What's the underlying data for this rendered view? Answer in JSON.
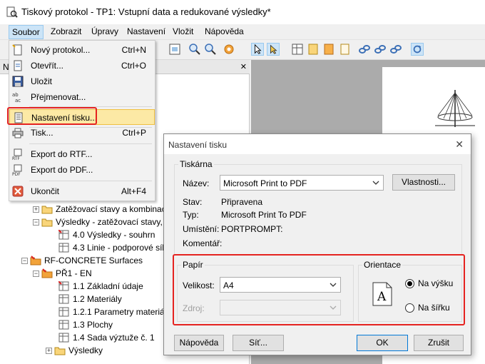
{
  "window": {
    "title": "Tiskový protokol - TP1: Vstupní data a redukované výsledky*"
  },
  "menubar": {
    "items": [
      "Soubor",
      "Zobrazit",
      "Úpravy",
      "Nastavení",
      "Vložit",
      "Nápověda"
    ]
  },
  "file_menu": {
    "items": [
      {
        "label": "Nový protokol...",
        "shortcut": "Ctrl+N",
        "icon": "new-document-icon"
      },
      {
        "label": "Otevřít...",
        "shortcut": "Ctrl+O",
        "icon": "open-folder-icon"
      },
      {
        "label": "Uložit",
        "shortcut": "",
        "icon": "save-disk-icon"
      },
      {
        "label": "Přejmenovat...",
        "shortcut": "",
        "icon": "rename-abc-icon"
      },
      {
        "label": "Nastavení tisku...",
        "shortcut": "",
        "icon": "print-setup-icon"
      },
      {
        "label": "Tisk...",
        "shortcut": "Ctrl+P",
        "icon": "printer-icon"
      },
      {
        "label": "Export do RTF...",
        "shortcut": "",
        "icon": "rtf-export-icon"
      },
      {
        "label": "Export do PDF...",
        "shortcut": "",
        "icon": "pdf-export-icon"
      },
      {
        "label": "Ukončit",
        "shortcut": "Alt+F4",
        "icon": "exit-icon"
      }
    ]
  },
  "navigator": {
    "header_letter": "N",
    "close": "✕",
    "tree": [
      {
        "label": "Zatěžovací stavy a kombinac",
        "icon": "folder-icon"
      },
      {
        "label": "Výsledky - zatěžovací stavy,",
        "icon": "folder-icon"
      },
      {
        "label": "4.0 Výsledky - souhrn",
        "icon": "table-icon"
      },
      {
        "label": "4.3 Linie - podporové síly",
        "icon": "table-icon"
      },
      {
        "label": "RF-CONCRETE Surfaces",
        "icon": "module-icon"
      },
      {
        "label": "PŘ1 - EN",
        "icon": "module-icon"
      },
      {
        "label": "1.1 Základní údaje",
        "icon": "table-icon"
      },
      {
        "label": "1.2 Materiály",
        "icon": "table-icon"
      },
      {
        "label": "1.2.1 Parametry materiál",
        "icon": "table-icon"
      },
      {
        "label": "1.3 Plochy",
        "icon": "table-icon"
      },
      {
        "label": "1.4 Sada výztuže č. 1",
        "icon": "table-icon"
      },
      {
        "label": "Výsledky",
        "icon": "folder-icon"
      }
    ]
  },
  "dialog": {
    "title": "Nastavení tisku",
    "close": "✕",
    "printer_group": "Tiskárna",
    "name_label": "Název:",
    "name_value": "Microsoft Print to PDF",
    "properties_button": "Vlastnosti...",
    "status_label": "Stav:",
    "status_value": "Připravena",
    "type_label": "Typ:",
    "type_value": "Microsoft Print To PDF",
    "location_label": "Umístění:",
    "location_value": "PORTPROMPT:",
    "comment_label": "Komentář:",
    "paper_group": "Papír",
    "size_label": "Velikost:",
    "size_value": "A4",
    "source_label": "Zdroj:",
    "orientation_group": "Orientace",
    "portrait_label": "Na výšku",
    "landscape_label": "Na šířku",
    "orientation_selected": "portrait",
    "help_button": "Nápověda",
    "network_button": "Síť...",
    "ok_button": "OK",
    "cancel_button": "Zrušit"
  },
  "colors": {
    "highlight_red": "#e52320",
    "menu_selected": "#fce9a5",
    "menubar_active": "#cce4f7"
  }
}
